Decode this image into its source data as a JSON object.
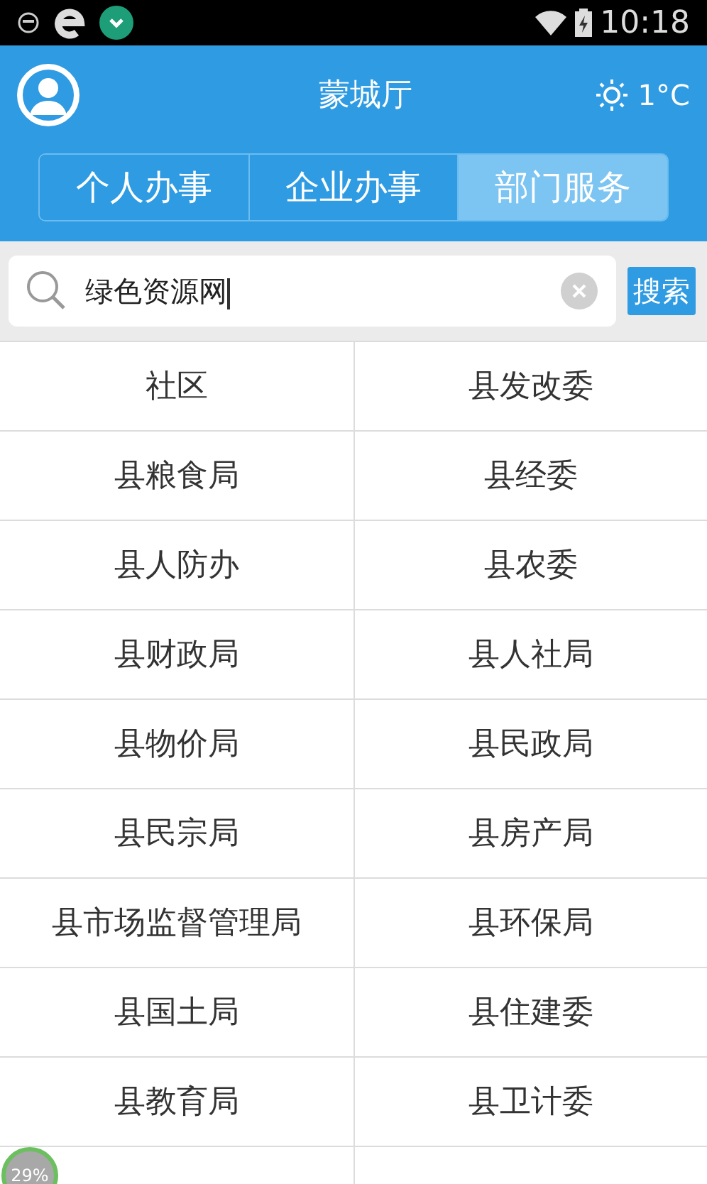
{
  "status_bar": {
    "time": "10:18"
  },
  "header": {
    "title": "蒙城厅",
    "weather": "1°C"
  },
  "tabs": [
    {
      "label": "个人办事",
      "selected": false
    },
    {
      "label": "企业办事",
      "selected": false
    },
    {
      "label": "部门服务",
      "selected": true
    }
  ],
  "search": {
    "value": "绿色资源网",
    "button": "搜索"
  },
  "departments": [
    [
      "社区",
      "县发改委"
    ],
    [
      "县粮食局",
      "县经委"
    ],
    [
      "县人防办",
      "县农委"
    ],
    [
      "县财政局",
      "县人社局"
    ],
    [
      "县物价局",
      "县民政局"
    ],
    [
      "县民宗局",
      "县房产局"
    ],
    [
      "县市场监督管理局",
      "县环保局"
    ],
    [
      "县国土局",
      "县住建委"
    ],
    [
      "县教育局",
      "县卫计委"
    ]
  ],
  "progress_badge": "29%"
}
